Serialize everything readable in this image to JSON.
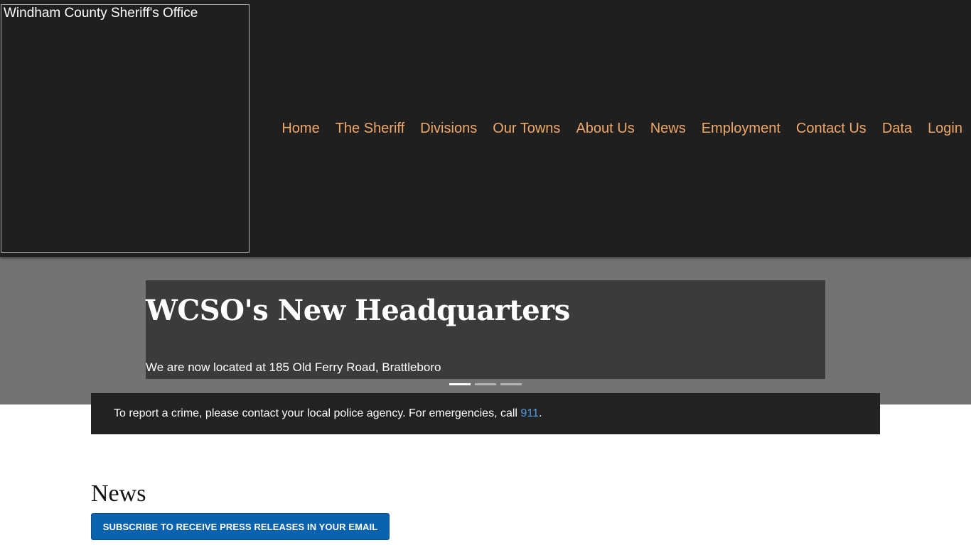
{
  "header": {
    "logo_alt": "Windham County Sheriff's Office",
    "nav": [
      "Home",
      "The Sheriff",
      "Divisions",
      "Our Towns",
      "About Us",
      "News",
      "Employment",
      "Contact Us",
      "Data",
      "Login"
    ]
  },
  "hero": {
    "slide_title": "WCSO's New Headquarters",
    "slide_text": "We are now located at 185 Old Ferry Road, Brattleboro",
    "slide_count": 3,
    "active_slide": 1
  },
  "alert": {
    "text_before": "To report a crime, please contact your local police agency. For emergencies, call ",
    "link": "911",
    "text_after": "."
  },
  "news": {
    "heading": "News",
    "subscribe_label": "SUBSCRIBE TO RECEIVE PRESS RELEASES IN YOUR EMAIL"
  },
  "colors": {
    "header_bg": "#1f1f1f",
    "nav_link": "#f0a868",
    "hero_bg": "#737373",
    "slide_bg": "#3b3b3b",
    "alert_bg": "#222222",
    "alert_link": "#4a9ee6",
    "button_bg": "#0b63b0"
  }
}
